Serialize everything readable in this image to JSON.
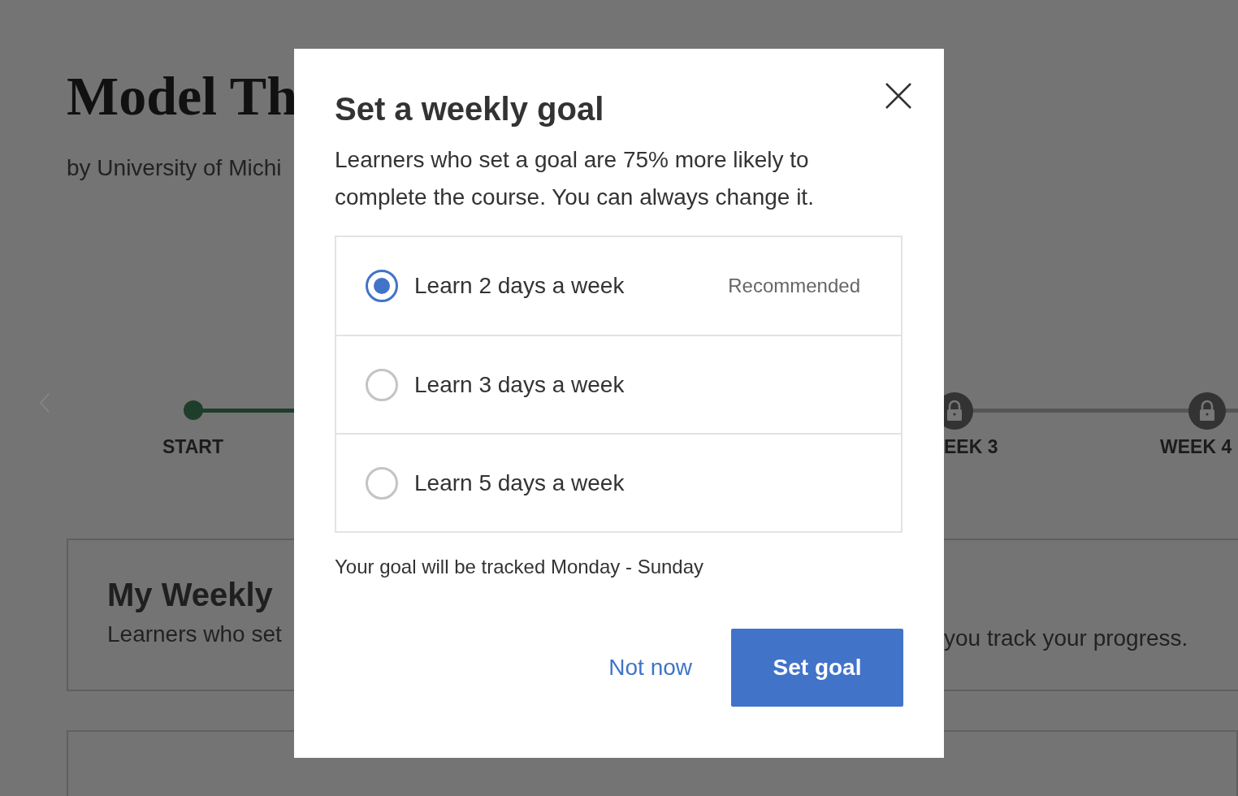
{
  "page": {
    "title": "Model Th",
    "subtitle": "by University of Michi",
    "timeline": [
      {
        "label": "START",
        "kind": "done"
      },
      {
        "label": "EEK 3",
        "kind": "locked"
      },
      {
        "label": "WEEK 4",
        "kind": "locked"
      }
    ],
    "goal_card": {
      "title": "My Weekly",
      "text_left": "Learners who set",
      "text_right": "you track your progress."
    }
  },
  "dialog": {
    "title": "Set a weekly goal",
    "description": "Learners who set a goal are 75% more likely to complete the course. You can always change it.",
    "options": [
      {
        "label": "Learn 2 days a week",
        "badge": "Recommended",
        "selected": true
      },
      {
        "label": "Learn 3 days a week",
        "selected": false
      },
      {
        "label": "Learn 5 days a week",
        "selected": false
      }
    ],
    "note": "Your goal will be tracked Monday - Sunday",
    "buttons": [
      {
        "label": "Not now",
        "kind": "link"
      },
      {
        "label": "Set goal",
        "kind": "primary"
      }
    ]
  }
}
